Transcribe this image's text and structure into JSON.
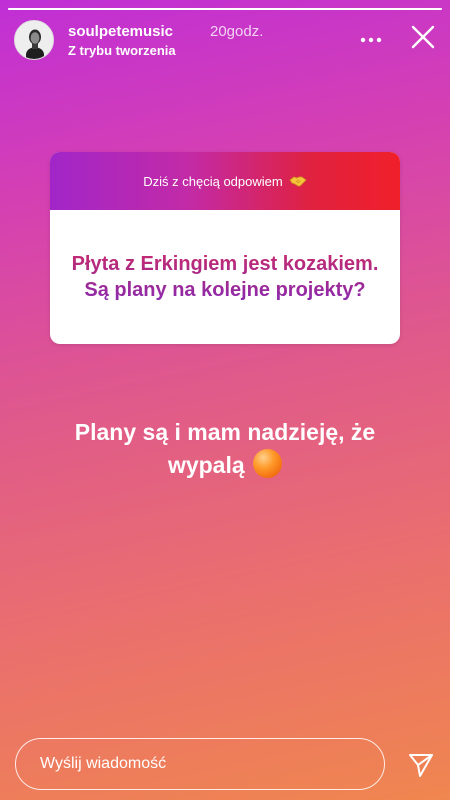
{
  "story": {
    "progress_fraction": 1.0,
    "username": "soulpetemusic",
    "time_ago": "20godz.",
    "subtitle": "Z trybu tworzenia"
  },
  "question_box": {
    "header_text": "Dziś z chęcią odpowiem",
    "header_icon": "handshake-emoji",
    "question": "Płyta z Erkingiem jest kozakiem. Są plany na kolejne projekty?"
  },
  "answer": {
    "text": "Plany są i mam nadzieję, że wypalą",
    "emoji": "orange-circle-emoji"
  },
  "footer": {
    "message_placeholder": "Wyślij wiadomość"
  },
  "colors": {
    "background_top": "#c02fd6",
    "background_bottom": "#f0864f",
    "question_header_start": "#a126c8",
    "question_header_end": "#f0202a",
    "question_text": "#b12a88"
  }
}
